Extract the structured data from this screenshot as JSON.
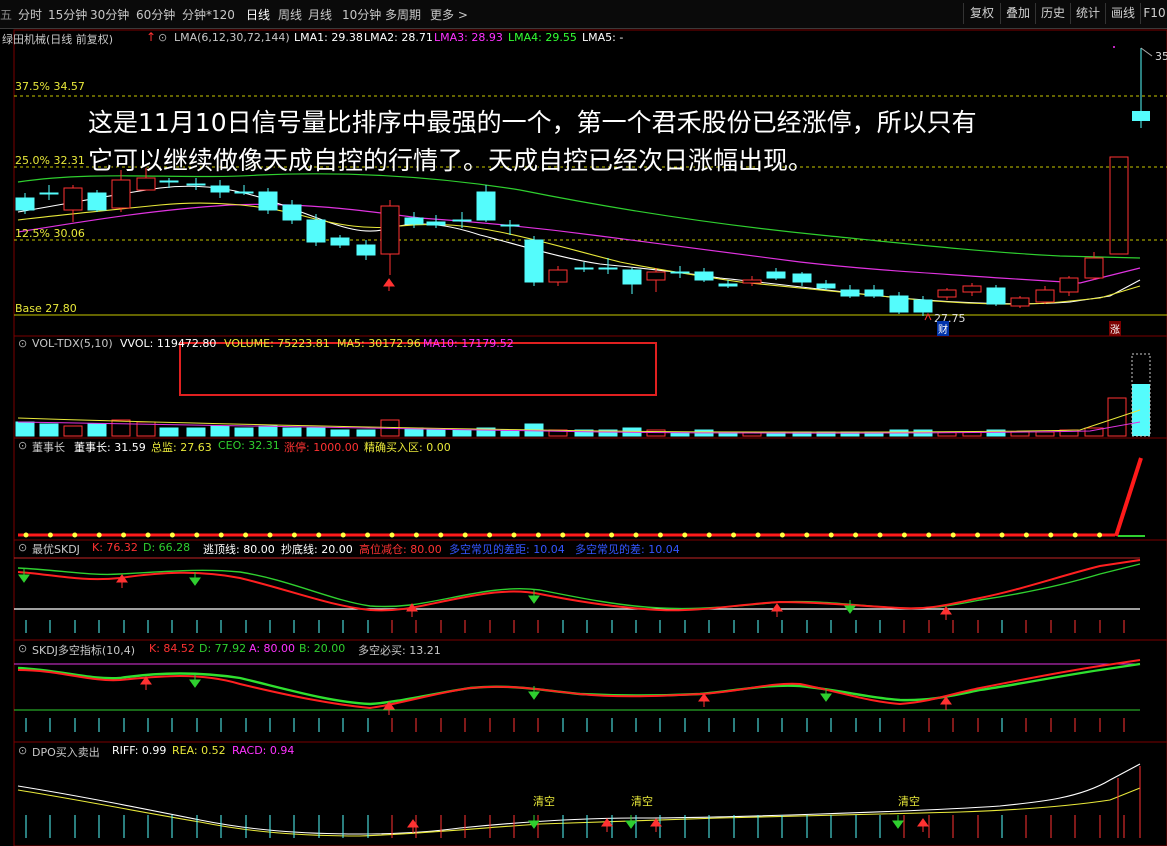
{
  "toolbar": {
    "left_cut": "五",
    "tabs": [
      "分时",
      "15分钟",
      "30分钟",
      "60分钟",
      "分钟*120",
      "日线",
      "周线",
      "月线",
      "10分钟",
      "多周期",
      "更多 >"
    ],
    "active_tab": "日线",
    "right_buttons": [
      "复权",
      "叠加",
      "历史",
      "统计",
      "画线",
      "F10"
    ]
  },
  "main_chart": {
    "stock": "绿田机械(日线 前复权)",
    "ma_label": "LMA(6,12,30,72,144)",
    "ma_values": [
      {
        "label": "LMA1: 29.38",
        "color": "#ffffff"
      },
      {
        "label": "LMA2: 28.71",
        "color": "#ffffff"
      },
      {
        "label": "LMA3: 28.93",
        "color": "#ff33ff"
      },
      {
        "label": "LMA4: 29.55",
        "color": "#33ff33"
      },
      {
        "label": "LMA5: -",
        "color": "#ffffff"
      }
    ],
    "levels": [
      "37.5% 34.57",
      "25.0% 32.31",
      "12.5% 30.06",
      "Base 27.80"
    ],
    "low_label": "27.75",
    "high_label": "35",
    "badge_cai": "财",
    "badge_zhang": "涨"
  },
  "annotation": {
    "line1": "这是11月10日信号量比排序中最强的一个，第一个君禾股份已经涨停，所以只有",
    "line2": "它可以继续做像天成自控的行情了。天成自控已经次日涨幅出现。"
  },
  "volume_panel": {
    "title": "VOL-TDX(5,10)",
    "vvol": "VVOL: 119472.80",
    "volume": "VOLUME: 75223.81",
    "ma5": "MA5: 30172.96",
    "ma10": "MA10: 17179.52"
  },
  "chairman_panel": {
    "title": "董事长",
    "v1": "董事长: 31.59",
    "v2": "总监: 27.63",
    "v3": "CEO: 32.31",
    "v4": "涨停: 1000.00",
    "v5": "精确买入区: 0.00"
  },
  "skdj_panel": {
    "title": "最优SKDJ",
    "k": "K: 76.32",
    "d": "D: 66.28",
    "top": "逃顶线: 80.00",
    "bottom": "抄底线: 20.00",
    "high": "高位减仓: 80.00",
    "diff1": "多空常见的差距: 10.04",
    "diff2": "多空常见的差: 10.04"
  },
  "skdj2_panel": {
    "title": "SKDJ多空指标(10,4)",
    "k": "K: 84.52",
    "d": "D: 77.92",
    "a": "A: 80.00",
    "b": "B: 20.00",
    "must": "多空必买: 13.21"
  },
  "dpo_panel": {
    "title": "DPO买入卖出",
    "riff": "RIFF: 0.99",
    "rea": "REA: 0.52",
    "racd": "RACD: 0.94",
    "clear_label": "清空"
  },
  "colors": {
    "up": "#ff3232",
    "down": "#54fcfc",
    "bg": "#000000",
    "grid": "#7a0000"
  }
}
